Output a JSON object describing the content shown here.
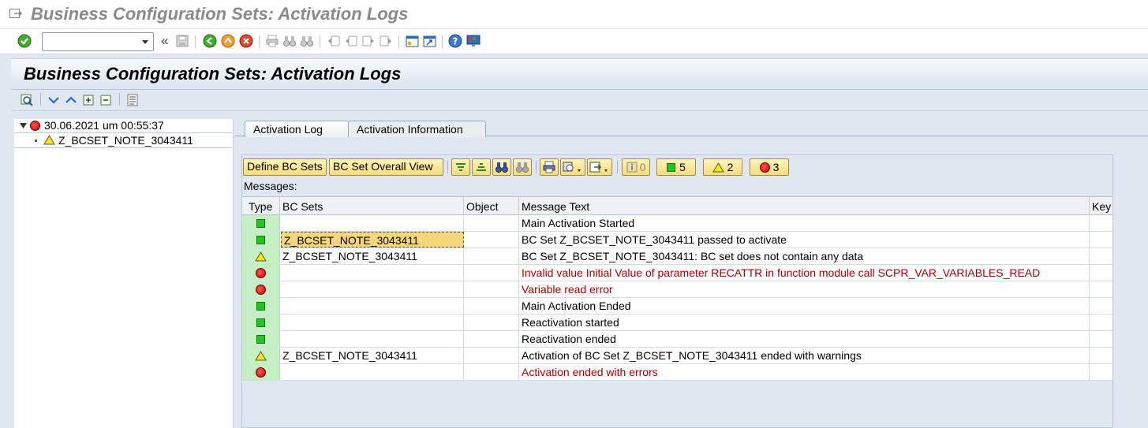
{
  "window": {
    "title": "Business Configuration Sets: Activation Logs"
  },
  "header": {
    "title": "Business Configuration Sets: Activation Logs"
  },
  "tree": {
    "items": [
      {
        "label": "30.06.2021 um 00:55:37",
        "status": "error"
      },
      {
        "label": "Z_BCSET_NOTE_3043411",
        "status": "warning"
      }
    ]
  },
  "tabs": [
    {
      "label": "Activation Log",
      "active": true
    },
    {
      "label": "Activation Information",
      "active": false
    }
  ],
  "toolbar": {
    "define_bc_sets": "Define BC Sets",
    "bc_set_overall_view": "BC Set Overall View",
    "info_count": "0",
    "success_count": "5",
    "warning_count": "2",
    "error_count": "3"
  },
  "messages_label": "Messages:",
  "grid": {
    "columns": [
      "Type",
      "BC Sets",
      "Object",
      "Message Text",
      "Key"
    ],
    "rows": [
      {
        "type": "success",
        "bc_set": "",
        "object": "",
        "text": "Main Activation Started"
      },
      {
        "type": "success",
        "bc_set": "Z_BCSET_NOTE_3043411",
        "object": "",
        "text": "BC Set Z_BCSET_NOTE_3043411 passed to activate"
      },
      {
        "type": "warning",
        "bc_set": "Z_BCSET_NOTE_3043411",
        "object": "",
        "text": "BC Set Z_BCSET_NOTE_3043411: BC set does not contain any data"
      },
      {
        "type": "error",
        "bc_set": "",
        "object": "",
        "text": "Invalid value Initial Value of parameter RECATTR in function module call SCPR_VAR_VARIABLES_READ"
      },
      {
        "type": "error",
        "bc_set": "",
        "object": "",
        "text": "Variable read error"
      },
      {
        "type": "success",
        "bc_set": "",
        "object": "",
        "text": "Main Activation Ended"
      },
      {
        "type": "success",
        "bc_set": "",
        "object": "",
        "text": "Reactivation started"
      },
      {
        "type": "success",
        "bc_set": "",
        "object": "",
        "text": "Reactivation ended"
      },
      {
        "type": "warning",
        "bc_set": "Z_BCSET_NOTE_3043411",
        "object": "",
        "text": "Activation of BC Set Z_BCSET_NOTE_3043411 ended with warnings"
      },
      {
        "type": "error",
        "bc_set": "",
        "object": "",
        "text": "Activation ended with errors"
      }
    ]
  },
  "colors": {
    "error_text": "#b00000",
    "success": "#1fc81f",
    "warning": "#ffe800",
    "error": "#d00000",
    "type_cell_bg": "#c4f0c4"
  }
}
